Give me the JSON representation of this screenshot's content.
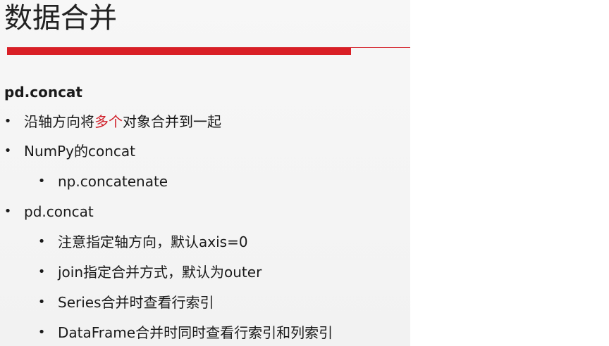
{
  "slide": {
    "title": "数据合并",
    "accent_color": "#d91f26",
    "section_heading": "pd.concat",
    "bullet_glyph": "•",
    "items": [
      {
        "level": 1,
        "parts": [
          "沿轴方向将",
          "多个",
          "对象合并到一起"
        ]
      },
      {
        "level": 1,
        "text": "NumPy的concat"
      },
      {
        "level": 2,
        "text": "np.concatenate"
      },
      {
        "level": 1,
        "text": "pd.concat"
      },
      {
        "level": 2,
        "text": "注意指定轴方向，默认axis=0"
      },
      {
        "level": 2,
        "text": "join指定合并方式，默认为outer"
      },
      {
        "level": 2,
        "text": "Series合并时查看行索引"
      },
      {
        "level": 2,
        "text": "DataFrame合并时同时查看行索引和列索引"
      }
    ]
  }
}
